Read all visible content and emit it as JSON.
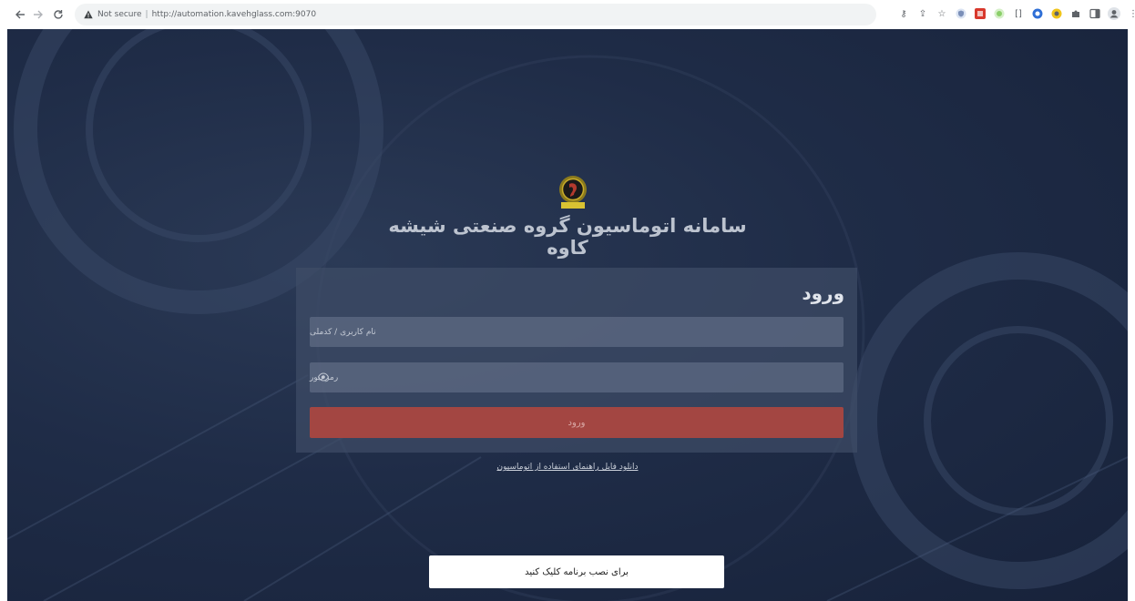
{
  "browser": {
    "back_icon": "arrow-left-icon",
    "forward_icon": "arrow-right-icon",
    "reload_icon": "reload-icon",
    "security_label": "Not secure",
    "url": "http://automation.kavehglass.com:9070",
    "extensions": [
      "key-icon",
      "share-icon",
      "star-icon",
      "shield-extension-icon",
      "red-extension-icon",
      "green-extension-icon",
      "bracket-extension-icon",
      "blue-extension-icon",
      "yellow-extension-icon",
      "puzzle-icon",
      "sidepanel-icon",
      "profile-icon",
      "menu-icon"
    ]
  },
  "header": {
    "site_title": "سامانه اتوماسیون گروه صنعتی شیشه کاوه"
  },
  "login": {
    "heading": "ورود",
    "username_placeholder": "نام کاربری / کدملی",
    "password_placeholder": "رمزعبور",
    "submit_label": "ورود"
  },
  "links": {
    "download_guide": "دانلود فایل راهنمای استفاده از اتوماسیون"
  },
  "install": {
    "label": "برای نصب برنامه کلیک کنید"
  },
  "colors": {
    "background": "#1f2c47",
    "submit": "#a34642",
    "card": "#3e4c66"
  }
}
